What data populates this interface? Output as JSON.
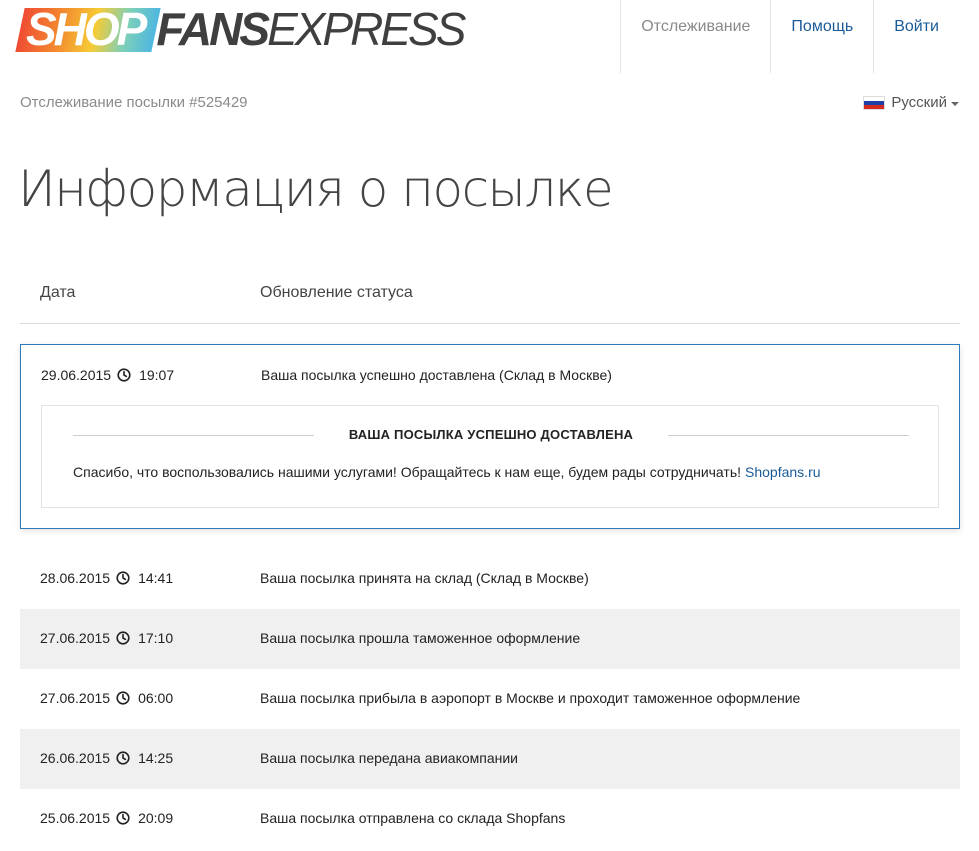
{
  "brand": {
    "part1": "SHOP",
    "part2": "FANS",
    "part3": "EXPRESS"
  },
  "nav": {
    "tracking": "Отслеживание",
    "help": "Помощь",
    "login": "Войти"
  },
  "breadcrumb": "Отслеживание посылки #525429",
  "language": {
    "label": "Русский",
    "flag": "ru-flag-icon"
  },
  "page_title": "Информация о посылке",
  "columns": {
    "date": "Дата",
    "status": "Обновление статуса"
  },
  "highlight": {
    "date": "29.06.2015",
    "time": "19:07",
    "status": "Ваша посылка успешно доставлена (Склад в Москве)",
    "detail_title": "ВАША ПОСЫЛКА УСПЕШНО ДОСТАВЛЕНА",
    "detail_message": "Спасибо, что воспользовались нашими услугами! Обращайтесь к нам еще, будем рады сотрудничать!",
    "detail_link": "Shopfans.ru"
  },
  "events": [
    {
      "date": "28.06.2015",
      "time": "14:41",
      "status": "Ваша посылка принята на склад (Склад в Москве)"
    },
    {
      "date": "27.06.2015",
      "time": "17:10",
      "status": "Ваша посылка прошла таможенное оформление"
    },
    {
      "date": "27.06.2015",
      "time": "06:00",
      "status": "Ваша посылка прибыла в аэропорт в Москве и проходит таможенное оформление"
    },
    {
      "date": "26.06.2015",
      "time": "14:25",
      "status": "Ваша посылка передана авиакомпании"
    },
    {
      "date": "25.06.2015",
      "time": "20:09",
      "status": "Ваша посылка отправлена со склада Shopfans"
    }
  ],
  "colors": {
    "link": "#1a5b98",
    "card_border": "#2e7ab8",
    "alt_row": "#f0f0f0"
  }
}
